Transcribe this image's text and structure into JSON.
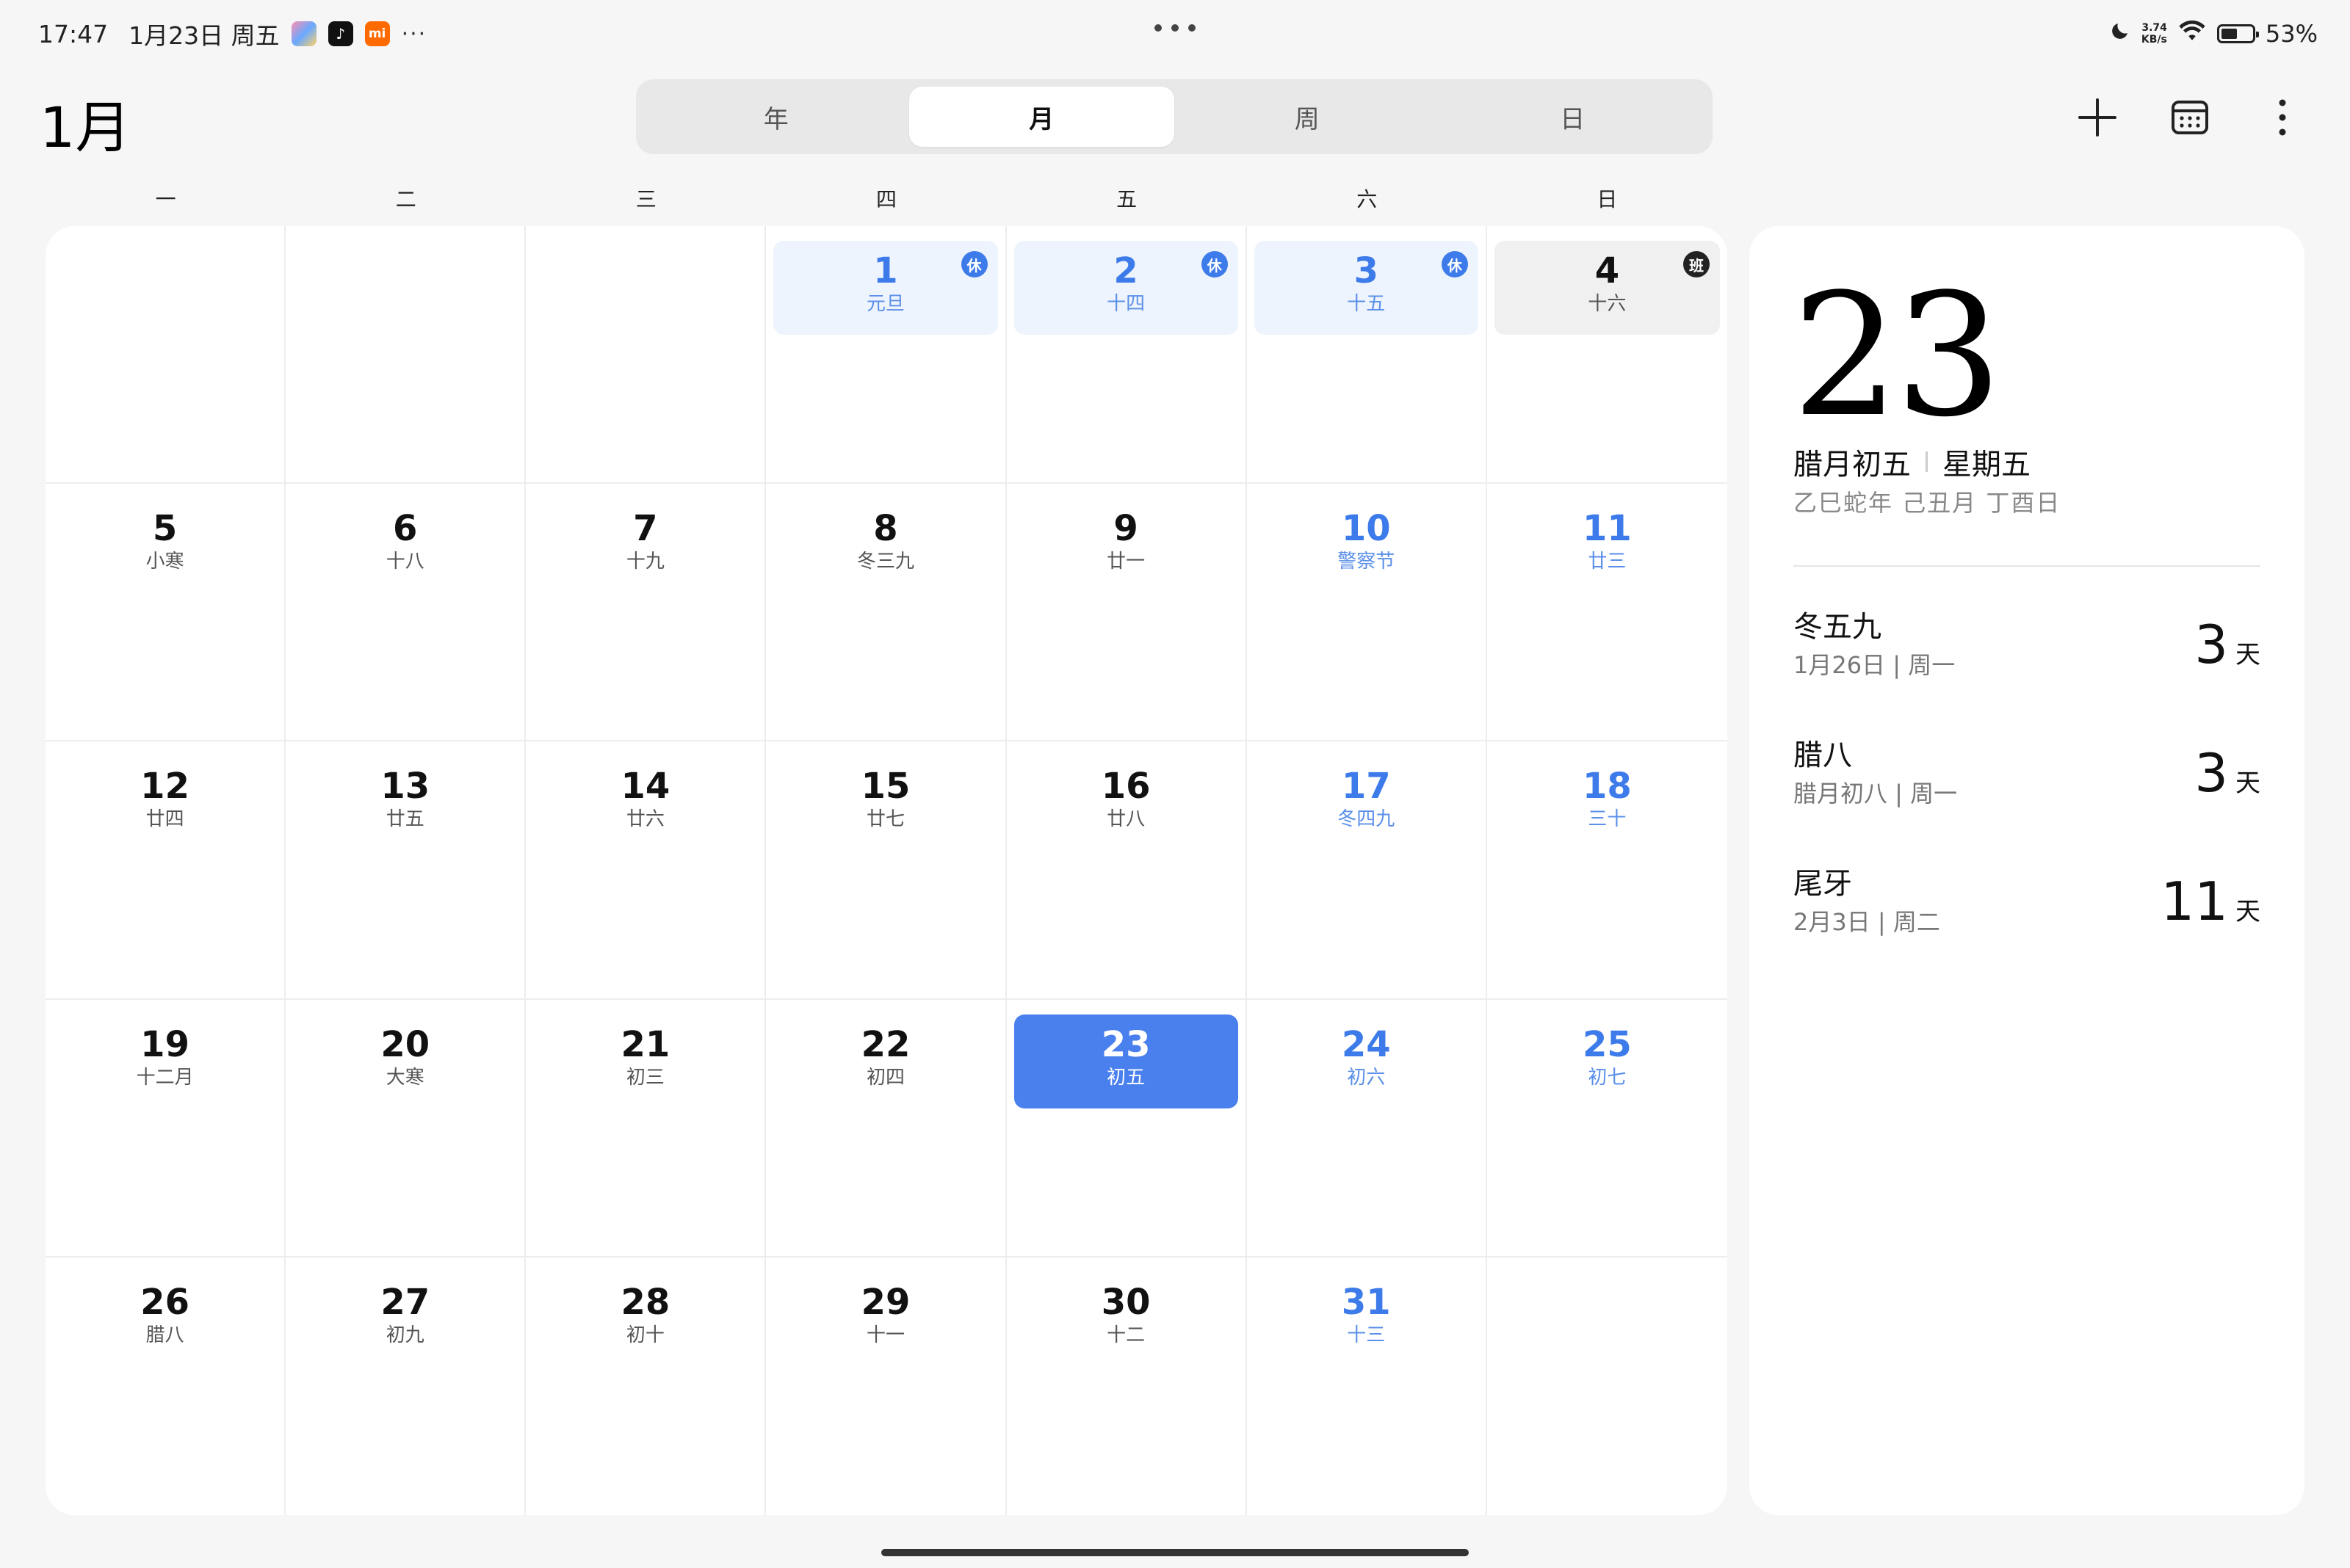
{
  "status_bar": {
    "time": "17:47",
    "date": "1月23日 周五",
    "more": "···",
    "net_speed_value": "3.74",
    "net_speed_unit": "KB/s",
    "battery": "53%",
    "battery_level": 0.53
  },
  "header": {
    "month_title": "1月",
    "views": [
      "年",
      "月",
      "周",
      "日"
    ],
    "active_view": "月"
  },
  "weekdays": [
    "一",
    "二",
    "三",
    "四",
    "五",
    "六",
    "日"
  ],
  "calendar": {
    "weeks": [
      [
        {
          "day": "",
          "sub": ""
        },
        {
          "day": "",
          "sub": ""
        },
        {
          "day": "",
          "sub": ""
        },
        {
          "day": "1",
          "sub": "元旦",
          "badge": "休",
          "type": "holiday",
          "blue": true
        },
        {
          "day": "2",
          "sub": "十四",
          "badge": "休",
          "type": "holiday",
          "blue": true
        },
        {
          "day": "3",
          "sub": "十五",
          "badge": "休",
          "type": "holiday",
          "blue": true
        },
        {
          "day": "4",
          "sub": "十六",
          "badge": "班",
          "type": "workday",
          "blue": false
        }
      ],
      [
        {
          "day": "5",
          "sub": "小寒"
        },
        {
          "day": "6",
          "sub": "十八"
        },
        {
          "day": "7",
          "sub": "十九"
        },
        {
          "day": "8",
          "sub": "冬三九"
        },
        {
          "day": "9",
          "sub": "廿一"
        },
        {
          "day": "10",
          "sub": "警察节",
          "blue": true
        },
        {
          "day": "11",
          "sub": "廿三",
          "blue": true
        }
      ],
      [
        {
          "day": "12",
          "sub": "廿四"
        },
        {
          "day": "13",
          "sub": "廿五"
        },
        {
          "day": "14",
          "sub": "廿六"
        },
        {
          "day": "15",
          "sub": "廿七"
        },
        {
          "day": "16",
          "sub": "廿八"
        },
        {
          "day": "17",
          "sub": "冬四九",
          "blue": true
        },
        {
          "day": "18",
          "sub": "三十",
          "blue": true
        }
      ],
      [
        {
          "day": "19",
          "sub": "十二月"
        },
        {
          "day": "20",
          "sub": "大寒"
        },
        {
          "day": "21",
          "sub": "初三"
        },
        {
          "day": "22",
          "sub": "初四"
        },
        {
          "day": "23",
          "sub": "初五",
          "type": "today"
        },
        {
          "day": "24",
          "sub": "初六",
          "blue": true
        },
        {
          "day": "25",
          "sub": "初七",
          "blue": true
        }
      ],
      [
        {
          "day": "26",
          "sub": "腊八"
        },
        {
          "day": "27",
          "sub": "初九"
        },
        {
          "day": "28",
          "sub": "初十"
        },
        {
          "day": "29",
          "sub": "十一"
        },
        {
          "day": "30",
          "sub": "十二"
        },
        {
          "day": "31",
          "sub": "十三",
          "blue": true
        },
        {
          "day": "",
          "sub": ""
        }
      ]
    ]
  },
  "panel": {
    "big_day": "23",
    "lunar": "腊月初五",
    "weekday": "星期五",
    "ganzhi": "乙巳蛇年 己丑月 丁酉日",
    "countdowns": [
      {
        "title": "冬五九",
        "date": "1月26日 | 周一",
        "num": "3",
        "unit": "天"
      },
      {
        "title": "腊八",
        "date": "腊月初八 | 周一",
        "num": "3",
        "unit": "天"
      },
      {
        "title": "尾牙",
        "date": "2月3日 | 周二",
        "num": "11",
        "unit": "天"
      }
    ]
  },
  "icons": {
    "add": "plus-icon",
    "today": "calendar-icon",
    "menu": "more-vertical-icon",
    "dnd": "moon-icon",
    "wifi": "wifi-icon",
    "battery": "battery-icon"
  },
  "colors": {
    "accent": "#4a80ee",
    "holiday_bg": "#eef4fd",
    "weekend_text": "#3d7bea"
  }
}
